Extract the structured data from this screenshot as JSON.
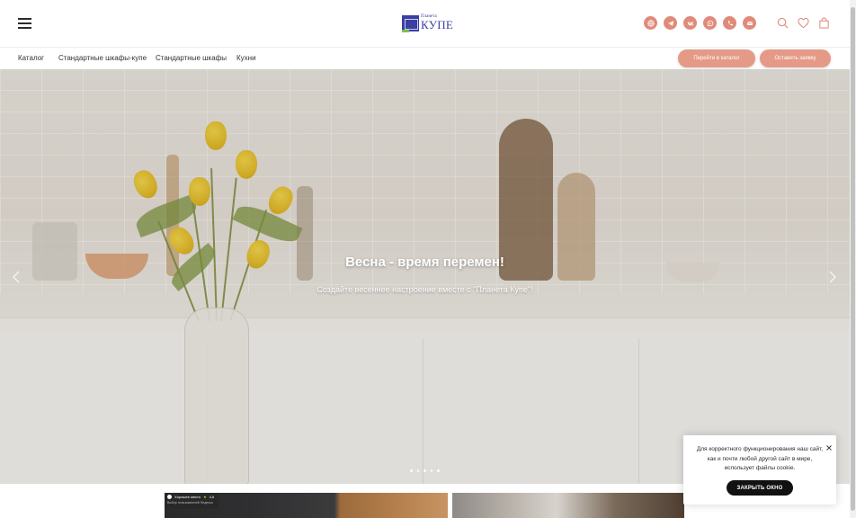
{
  "header": {
    "logo": {
      "small_text": "Планета",
      "big_text": "КУПЕ"
    },
    "socials": [
      {
        "name": "site",
        "icon": "globe-icon"
      },
      {
        "name": "telegram",
        "icon": "telegram-icon"
      },
      {
        "name": "vk",
        "icon": "vk-icon"
      },
      {
        "name": "whatsapp",
        "icon": "whatsapp-icon"
      },
      {
        "name": "phone",
        "icon": "phone-icon"
      },
      {
        "name": "email",
        "icon": "mail-icon"
      }
    ],
    "accent_color": "#e08b7a"
  },
  "nav": {
    "items": [
      {
        "label": "Каталог"
      },
      {
        "label": "Стандартные шкафы-купе"
      },
      {
        "label": "Стандартные шкафы"
      },
      {
        "label": "Кухни"
      }
    ],
    "catalog_button": "Перейти в каталог",
    "request_button": "Оставить заявку"
  },
  "hero": {
    "title": "Весна - время перемен!",
    "subtitle": "Создайте весеннее настроение вместе с \"Планета Купе\"!",
    "slides_count": 5
  },
  "badge": {
    "title": "Хорошее место",
    "rating": "4,6",
    "caption": "Выбор пользователей Яндекса"
  },
  "cookie": {
    "text": "Для корректного функционирования наш сайт, как и почти любой другой сайт в мире, использует файлы cookie.",
    "button": "ЗАКРЫТЬ ОКНО"
  }
}
